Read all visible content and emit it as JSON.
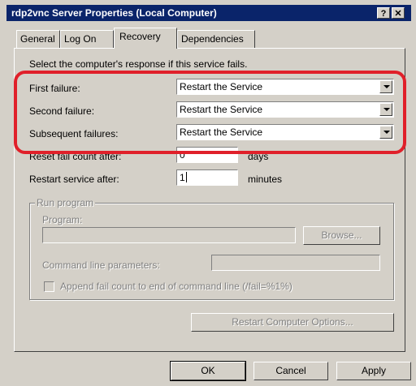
{
  "window": {
    "title": "rdp2vnc Server Properties (Local Computer)",
    "help_button": "?",
    "close_button": "✕"
  },
  "tabs": [
    {
      "label": "General",
      "active": false
    },
    {
      "label": "Log On",
      "active": false
    },
    {
      "label": "Recovery",
      "active": true
    },
    {
      "label": "Dependencies",
      "active": false
    }
  ],
  "recovery": {
    "instruction": "Select the computer's response if this service fails.",
    "first_failure": {
      "label": "First failure:",
      "value": "Restart the Service"
    },
    "second_failure": {
      "label": "Second failure:",
      "value": "Restart the Service"
    },
    "subsequent_failures": {
      "label": "Subsequent failures:",
      "value": "Restart the Service"
    },
    "reset_fail_count": {
      "label": "Reset fail count after:",
      "value": "0",
      "unit": "days"
    },
    "restart_service": {
      "label": "Restart service after:",
      "value": "1",
      "unit": "minutes"
    }
  },
  "run_program": {
    "group_label": "Run program",
    "program_label": "Program:",
    "program_value": "",
    "browse_label": "Browse...",
    "params_label": "Command line parameters:",
    "params_value": "",
    "append_label": "Append fail count to end of command line (/fail=%1%)"
  },
  "restart_computer_options_label": "Restart Computer Options...",
  "footer": {
    "ok_label": "OK",
    "cancel_label": "Cancel",
    "apply_label": "Apply"
  },
  "colors": {
    "titlebar": "#0a246a",
    "dialog_face": "#d4d0c8",
    "highlight_annotation": "#e0202a"
  }
}
